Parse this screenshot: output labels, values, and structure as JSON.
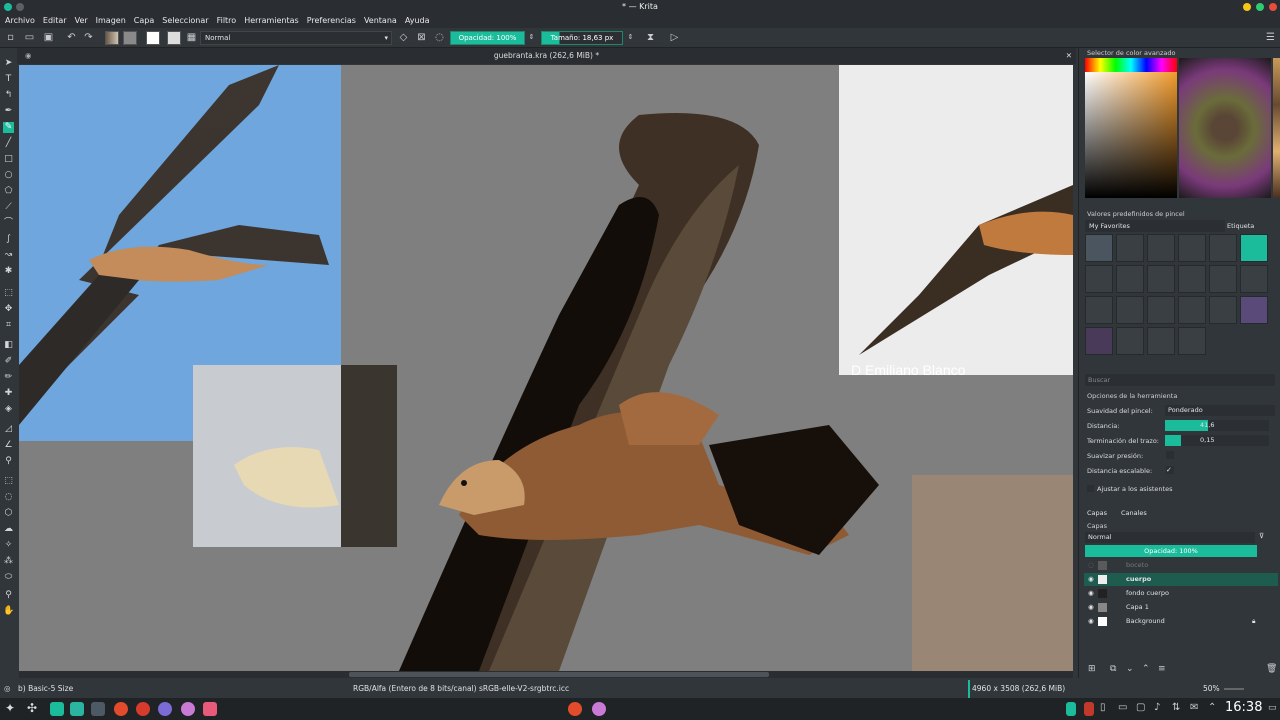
{
  "window": {
    "title": "* — Krita"
  },
  "menu": [
    "Archivo",
    "Editar",
    "Ver",
    "Imagen",
    "Capa",
    "Seleccionar",
    "Filtro",
    "Herramientas",
    "Preferencias",
    "Ventana",
    "Ayuda"
  ],
  "toolbar": {
    "blend_mode": "Normal",
    "opacity_label": "Opacidad:  100%",
    "size_label": "Tamaño:  18,63 px"
  },
  "document": {
    "tab_title": "guebranta.kra (262,6 MiB) *",
    "watermark": "D Emiliano Blanco"
  },
  "dock": {
    "color_title": "Selector de color avanzado",
    "presets_title": "Valores predefinidos de pincel",
    "favorites": "My Favorites",
    "tag_label": "Etiqueta",
    "search_placeholder": "Buscar",
    "tool_options_title": "Opciones de la herramienta",
    "smoothing_label": "Suavidad del pincel:",
    "smoothing_value": "Ponderado",
    "distance_label": "Distancia:",
    "distance_value": "41,6",
    "distance_fill": 0.41,
    "stroke_end_label": "Terminación del trazo:",
    "stroke_end_value": "0,15",
    "stroke_end_fill": 0.15,
    "smooth_pressure_label": "Suavizar presión:",
    "scalable_distance_label": "Distancia escalable:",
    "scalable_distance_check": "✓",
    "snap_label": "Ajustar a los asistentes",
    "tab_layers": "Capas",
    "tab_channels": "Canales",
    "layers_title": "Capas",
    "layers_blend": "Normal",
    "layers_opacity": "Opacidad: 100%",
    "layers": [
      {
        "name": "boceto"
      },
      {
        "name": "cuerpo"
      },
      {
        "name": "fondo cuerpo"
      },
      {
        "name": "Capa 1"
      },
      {
        "name": "Background"
      }
    ]
  },
  "status": {
    "brush": "b) Basic-5 Size",
    "color_profile": "RGB/Alfa (Entero de 8 bits/canal)  sRGB-elle-V2-srgbtrc.icc",
    "dimensions": "4960 x 3508 (262,6 MiB)",
    "zoom": "50%"
  },
  "taskbar": {
    "clock": "16:38"
  },
  "colors": {
    "accent": "#1abc9c",
    "panel": "#31363b",
    "canvas_bg": "#7f7f7f",
    "sky": "#6ea6dd"
  }
}
